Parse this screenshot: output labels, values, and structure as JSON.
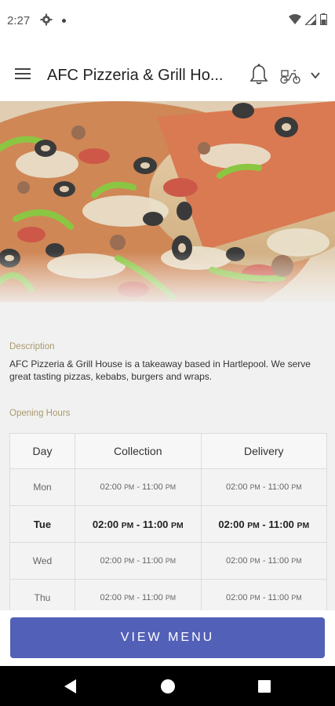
{
  "status": {
    "time": "2:27"
  },
  "appbar": {
    "title": "AFC Pizzeria & Grill Ho..."
  },
  "description": {
    "label": "Description",
    "text": "AFC Pizzeria & Grill House is a takeaway based in Hartlepool. We serve great tasting pizzas, kebabs, burgers and wraps."
  },
  "hours": {
    "label": "Opening Hours",
    "headers": {
      "day": "Day",
      "collection": "Collection",
      "delivery": "Delivery"
    },
    "rows": [
      {
        "day": "Mon",
        "collection_open": "02:00",
        "collection_open_ampm": "PM",
        "collection_close": "11:00",
        "collection_close_ampm": "PM",
        "delivery_open": "02:00",
        "delivery_open_ampm": "PM",
        "delivery_close": "11:00",
        "delivery_close_ampm": "PM"
      },
      {
        "day": "Tue",
        "collection_open": "02:00",
        "collection_open_ampm": "PM",
        "collection_close": "11:00",
        "collection_close_ampm": "PM",
        "delivery_open": "02:00",
        "delivery_open_ampm": "PM",
        "delivery_close": "11:00",
        "delivery_close_ampm": "PM"
      },
      {
        "day": "Wed",
        "collection_open": "02:00",
        "collection_open_ampm": "PM",
        "collection_close": "11:00",
        "collection_close_ampm": "PM",
        "delivery_open": "02:00",
        "delivery_open_ampm": "PM",
        "delivery_close": "11:00",
        "delivery_close_ampm": "PM"
      },
      {
        "day": "Thu",
        "collection_open": "02:00",
        "collection_open_ampm": "PM",
        "collection_close": "11:00",
        "collection_close_ampm": "PM",
        "delivery_open": "02:00",
        "delivery_open_ampm": "PM",
        "delivery_close": "11:00",
        "delivery_close_ampm": "PM"
      }
    ],
    "separator": " - "
  },
  "cta": {
    "label": "VIEW MENU"
  },
  "colors": {
    "accent": "#5360b8",
    "label": "#a8996c"
  }
}
